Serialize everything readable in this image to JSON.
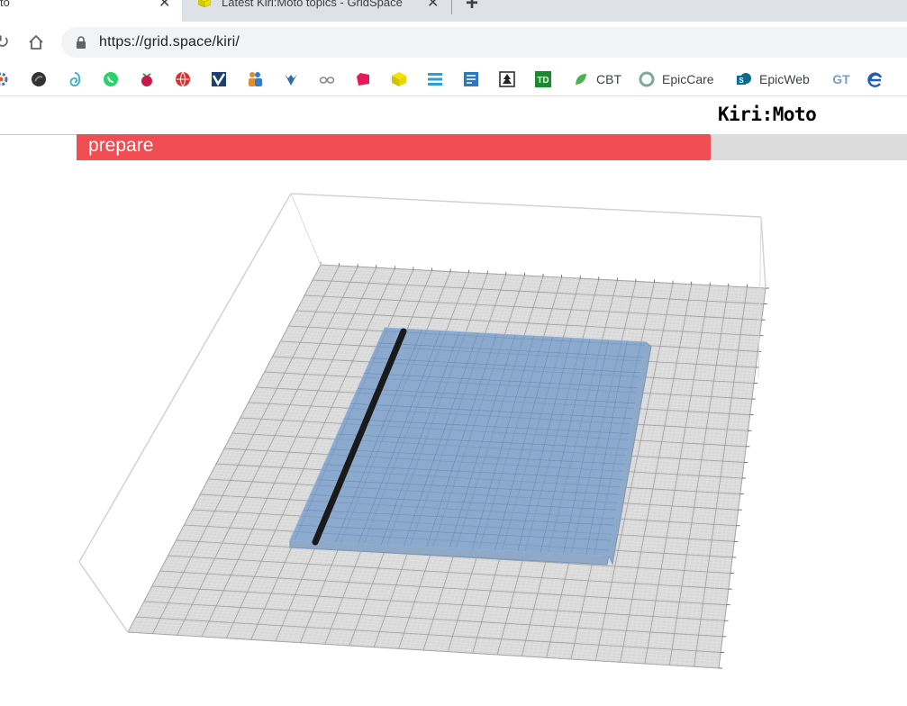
{
  "browser": {
    "tabs": [
      {
        "title": "to",
        "active": true
      },
      {
        "title": "Latest Kiri:Moto topics - GridSpace",
        "active": false
      }
    ],
    "close_glyph": "✕",
    "new_tab_glyph": "+",
    "url": "https://grid.space/kiri/",
    "bookmarks": [
      {
        "icon": "settings-icon",
        "label": ""
      },
      {
        "icon": "dark-circle-icon",
        "label": ""
      },
      {
        "icon": "swirl-icon",
        "label": ""
      },
      {
        "icon": "whatsapp-icon",
        "label": ""
      },
      {
        "icon": "raspberry-pi-icon",
        "label": ""
      },
      {
        "icon": "globe-icon",
        "label": ""
      },
      {
        "icon": "check-mark-icon",
        "label": ""
      },
      {
        "icon": "people-icon",
        "label": ""
      },
      {
        "icon": "birds-icon",
        "label": ""
      },
      {
        "icon": "glasses-icon",
        "label": ""
      },
      {
        "icon": "pink-shape-icon",
        "label": ""
      },
      {
        "icon": "yellow-cube-icon",
        "label": ""
      },
      {
        "icon": "layers-icon",
        "label": ""
      },
      {
        "icon": "document-icon",
        "label": ""
      },
      {
        "icon": "tree-icon",
        "label": ""
      },
      {
        "icon": "td-bank-icon",
        "label": ""
      },
      {
        "icon": "leaf-icon",
        "label": "CBT"
      },
      {
        "icon": "epic-care-icon",
        "label": "EpicCare"
      },
      {
        "icon": "sharepoint-icon",
        "label": "EpicWeb"
      },
      {
        "icon": "gt-icon",
        "label": ""
      },
      {
        "icon": "edge-icon",
        "label": ""
      }
    ]
  },
  "app": {
    "logo": "Kiri:Moto",
    "progress": {
      "label": "prepare",
      "percent": 76.4
    }
  },
  "colors": {
    "progress_fill": "#f04e52",
    "progress_track": "#dcdcdc",
    "bed": "#d7d7d7",
    "part": "#7ea3cc",
    "part_edge": "#1a1a1a"
  }
}
